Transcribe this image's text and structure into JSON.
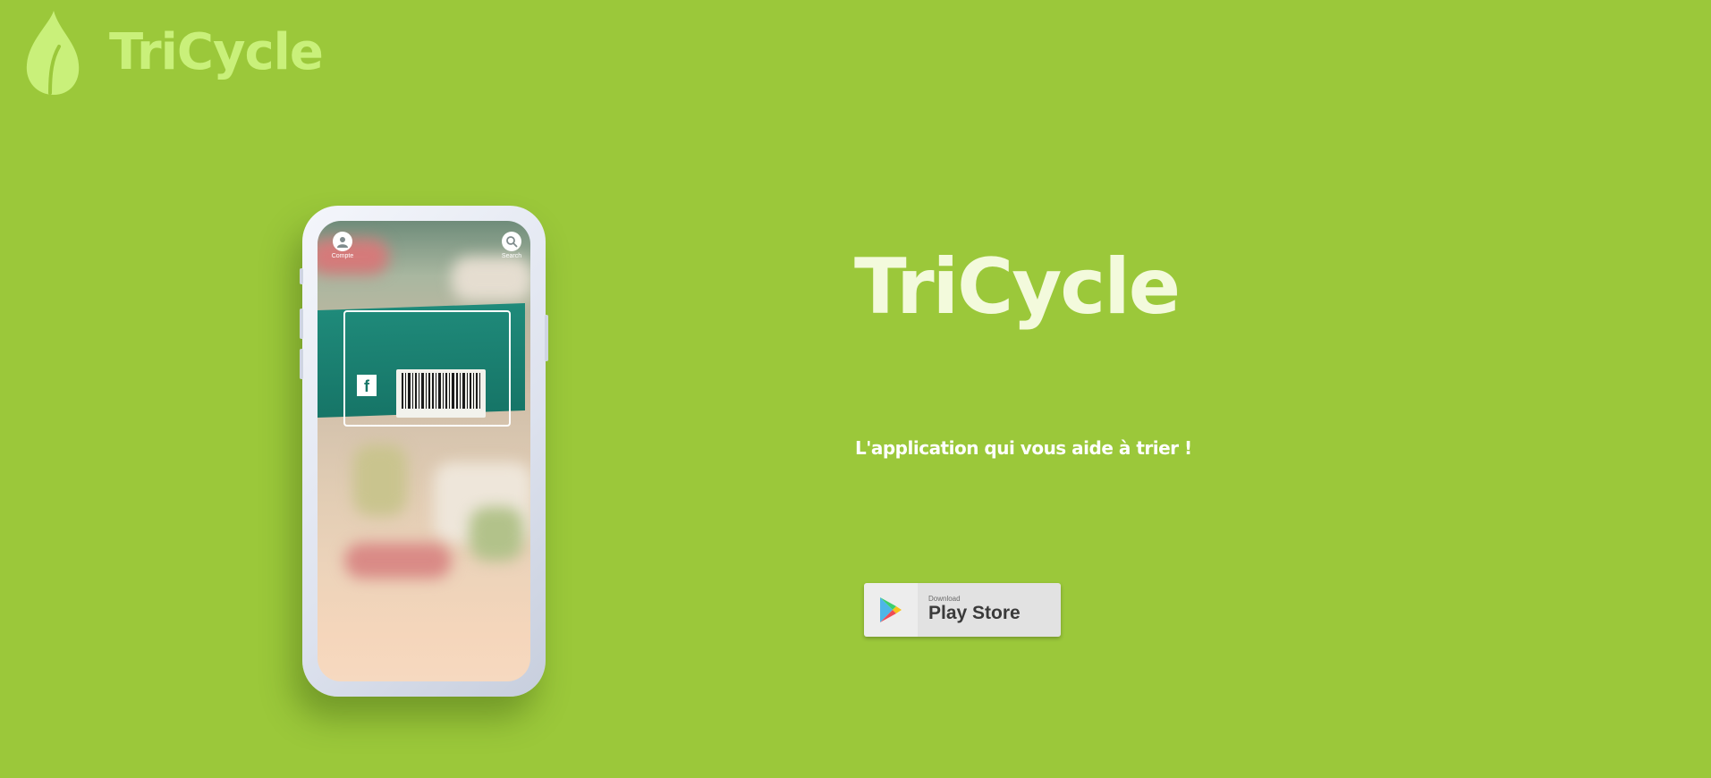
{
  "header": {
    "logo_text": "TriCycle"
  },
  "phone": {
    "left_icon_label": "Compte",
    "right_icon_label": "Search"
  },
  "hero": {
    "title": "TriCycle",
    "subtitle": "L'application qui vous aide à trier !"
  },
  "store_button": {
    "small_label": "Download",
    "main_label": "Play Store"
  },
  "icons": {
    "logo": "leaf-icon",
    "account": "user-icon",
    "search": "search-icon",
    "store": "google-play-icon"
  },
  "colors": {
    "background": "#9bc83a",
    "logo": "#c9f07a",
    "title": "#f3fadc",
    "subtitle": "#ffffff",
    "button": "#e2e2e2"
  }
}
